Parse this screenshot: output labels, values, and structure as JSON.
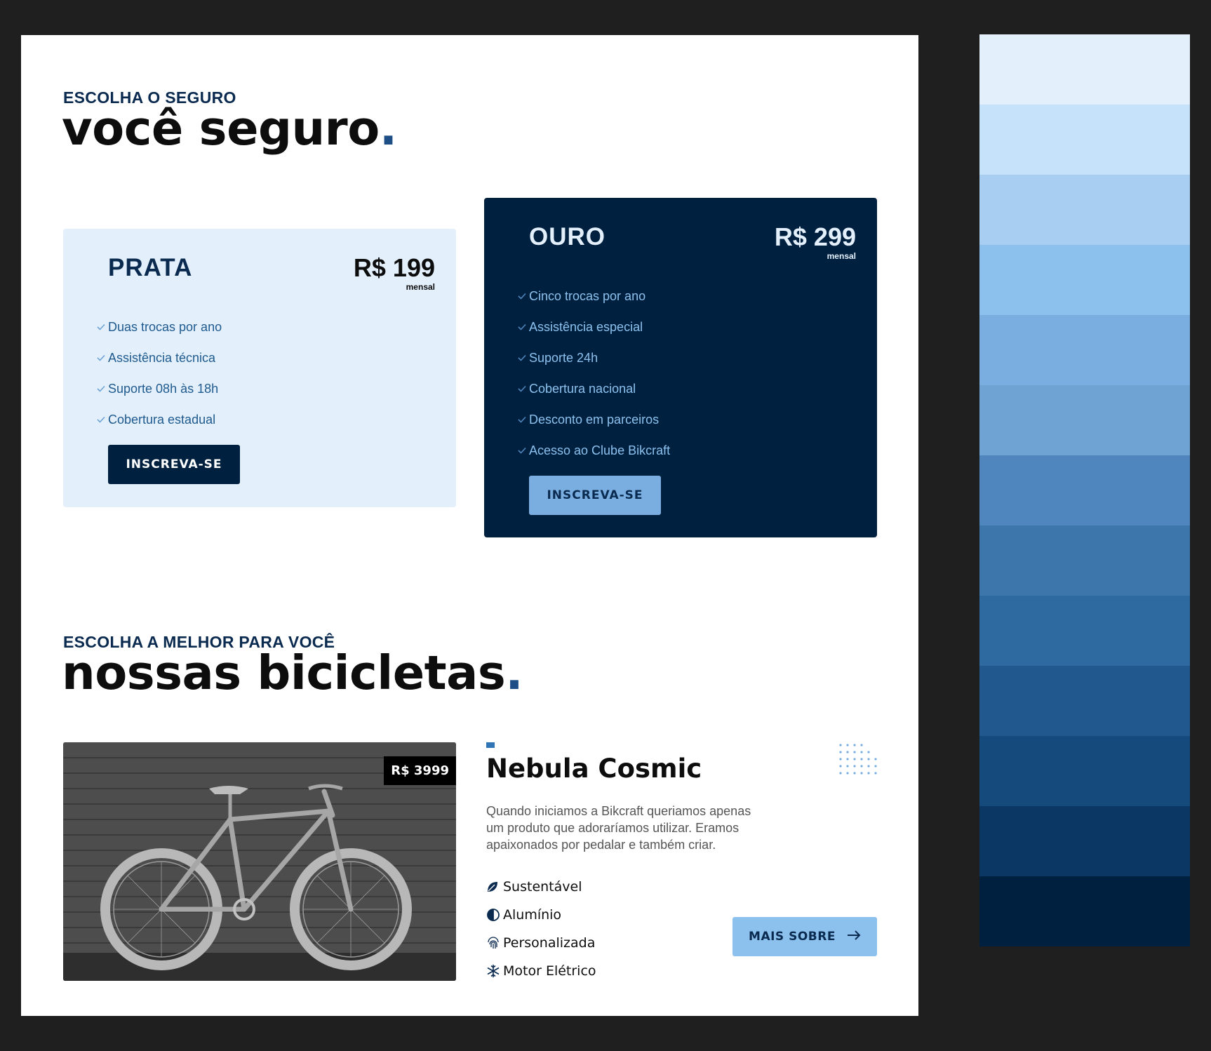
{
  "insurance": {
    "eyebrow": "ESCOLHA O SEGURO",
    "title": "você seguro",
    "title_dot": ".",
    "plans": [
      {
        "name": "PRATA",
        "price": "R$ 199",
        "period": "mensal",
        "features": [
          "Duas trocas por ano",
          "Assistência técnica",
          "Suporte 08h às 18h",
          "Cobertura estadual"
        ],
        "button": "INSCREVA-SE"
      },
      {
        "name": "OURO",
        "price": "R$ 299",
        "period": "mensal",
        "features": [
          "Cinco trocas por ano",
          "Assistência especial",
          "Suporte 24h",
          "Cobertura nacional",
          "Desconto em parceiros",
          "Acesso ao Clube Bikcraft"
        ],
        "button": "INSCREVA-SE"
      }
    ]
  },
  "bikes": {
    "eyebrow": "ESCOLHA A MELHOR PARA VOCÊ",
    "title": "nossas bicicletas",
    "title_dot": ".",
    "featured": {
      "price_tag": "R$ 3999",
      "name": "Nebula Cosmic",
      "description": "Quando iniciamos a Bikcraft queriamos apenas um produto que adoraríamos utilizar. Eramos apaixonados por pedalar e também criar.",
      "specs": [
        {
          "label": "Sustentável",
          "icon": "leaf-icon"
        },
        {
          "label": "Alumínio",
          "icon": "half-circle-icon"
        },
        {
          "label": "Personalizada",
          "icon": "fingerprint-icon"
        },
        {
          "label": "Motor Elétrico",
          "icon": "snowflake-icon"
        }
      ],
      "button": "MAIS SOBRE"
    }
  },
  "palette": [
    "#e3f0fc",
    "#c6e1fa",
    "#a8cff2",
    "#8cc1ee",
    "#7aaee0",
    "#6ea3d4",
    "#4f86bd",
    "#3d76ab",
    "#2e6aa0",
    "#21598f",
    "#154a7d",
    "#0a3764",
    "#00203f"
  ]
}
